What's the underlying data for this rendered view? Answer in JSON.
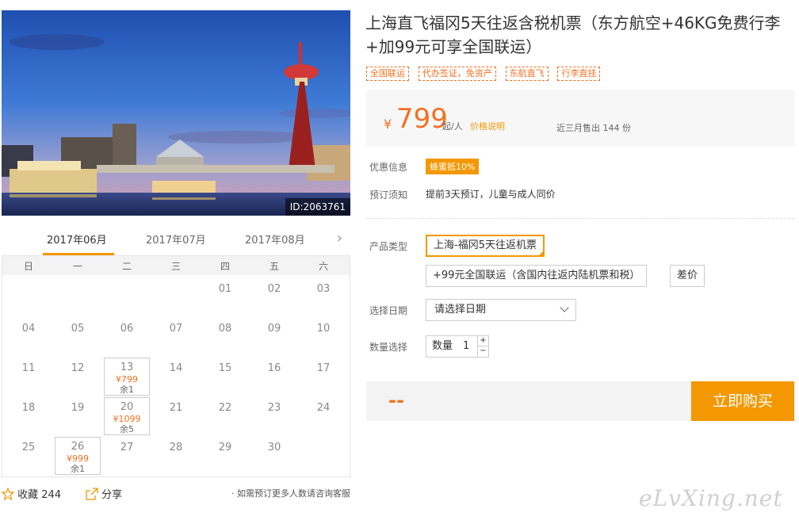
{
  "hero": {
    "photo_id": "ID:2063761"
  },
  "calendar": {
    "months": [
      "2017年06月",
      "2017年07月",
      "2017年08月"
    ],
    "weekdays": [
      "日",
      "一",
      "二",
      "三",
      "四",
      "五",
      "六"
    ],
    "days": {
      "d01": "01",
      "d02": "02",
      "d03": "03",
      "d04": "04",
      "d05": "05",
      "d06": "06",
      "d07": "07",
      "d08": "08",
      "d09": "09",
      "d10": "10",
      "d11": "11",
      "d12": "12",
      "d14": "14",
      "d15": "15",
      "d16": "16",
      "d17": "17",
      "d18": "18",
      "d19": "19",
      "d21": "21",
      "d22": "22",
      "d23": "23",
      "d24": "24",
      "d25": "25",
      "d27": "27",
      "d28": "28",
      "d29": "29",
      "d30": "30"
    },
    "available": [
      {
        "day": "13",
        "price": "¥799",
        "remain": "余1"
      },
      {
        "day": "20",
        "price": "¥1099",
        "remain": "余5"
      },
      {
        "day": "26",
        "price": "¥999",
        "remain": "余1"
      }
    ]
  },
  "actions": {
    "favorite_label": "收藏 244",
    "share_label": "分享",
    "note": "· 如需预订更多人数请咨询客服"
  },
  "product": {
    "title": "上海直飞福冈5天往返含税机票（东方航空+46KG免费行李+加99元可享全国联运）",
    "tags": [
      "全国联运",
      "代办签证，免资产",
      "东航直飞",
      "行李直挂"
    ]
  },
  "price": {
    "currency": "¥",
    "value": "799",
    "unit": "起/人",
    "explain_link": "价格说明",
    "sold": "近三月售出 144 份"
  },
  "info": {
    "discount_label": "优惠信息",
    "discount_badge": "蜂蜜抵10%",
    "notice_label": "预订须知",
    "notice_text": "提前3天预订，儿童与成人同价"
  },
  "form": {
    "product_type_label": "产品类型",
    "options": [
      "上海-福冈5天往返机票",
      "+99元全国联运（含国内往返内陆机票和税）",
      "差价"
    ],
    "date_label": "选择日期",
    "date_placeholder": "请选择日期",
    "qty_label": "数量选择",
    "qty_prefix": "数量",
    "qty_value": "1",
    "qty_up": "+",
    "qty_down": "−"
  },
  "buy": {
    "price_placeholder": "--",
    "button_label": "立即购买"
  },
  "watermark": "eLvXing.net",
  "colors": {
    "accent": "#f39800",
    "price": "#f37021"
  }
}
